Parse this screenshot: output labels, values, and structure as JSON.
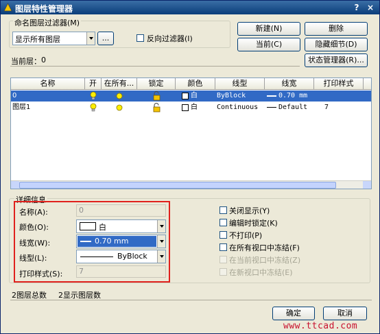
{
  "window": {
    "title": "图层特性管理器",
    "help_glyph": "?",
    "close_glyph": "×"
  },
  "filter": {
    "group_label": "命名图层过滤器(M)",
    "selected": "显示所有图层",
    "browse_label": "...",
    "invert_label": "反向过滤器(I)",
    "invert_checked": false
  },
  "current_layer": {
    "label": "当前层：",
    "value": "0"
  },
  "buttons": {
    "new": "新建(N)",
    "delete": "删除",
    "current": "当前(C)",
    "hide_details": "隐藏细节(D)",
    "state_manager": "状态管理器(R)...",
    "ok": "确定",
    "cancel": "取消"
  },
  "table": {
    "columns": [
      "名称",
      "开",
      "在所有...",
      "锁定",
      "颜色",
      "线型",
      "线宽",
      "打印样式"
    ],
    "rows": [
      {
        "name": "0",
        "color_name": "白",
        "linetype": "ByBlock",
        "lineweight": "0.70 mm",
        "plot_style": "",
        "selected": true
      },
      {
        "name": "图层1",
        "color_name": "白",
        "linetype": "Continuous",
        "lineweight": "Default",
        "plot_style": "7",
        "selected": false
      }
    ]
  },
  "details": {
    "group_label": "详细信息",
    "name_label": "名称(A):",
    "name_value": "0",
    "color_label": "颜色(O):",
    "color_value": "白",
    "lineweight_label": "线宽(W):",
    "lineweight_value": "0.70 mm",
    "linetype_label": "线型(L):",
    "linetype_value": "ByBlock",
    "plotstyle_label": "打印样式(S):",
    "plotstyle_value": "7",
    "checkboxes": [
      {
        "label": "关闭显示(Y)",
        "checked": false,
        "enabled": true
      },
      {
        "label": "编辑时锁定(K)",
        "checked": false,
        "enabled": true
      },
      {
        "label": "不打印(P)",
        "checked": false,
        "enabled": true
      },
      {
        "label": "在所有视口中冻结(F)",
        "checked": false,
        "enabled": true
      },
      {
        "label": "在当前视口中冻结(Z)",
        "checked": false,
        "enabled": false
      },
      {
        "label": "在新视口中冻结(E)",
        "checked": false,
        "enabled": false
      }
    ]
  },
  "status": {
    "total": "2图层总数",
    "shown": "2显示图层数"
  },
  "watermark": "www.ttcad.com",
  "colors": {
    "title_bar": "#0a3d7a",
    "selection": "#316ac5",
    "highlight_border": "#e0201c",
    "bulb_on": "#ffee00",
    "watermark": "#c8102e"
  }
}
